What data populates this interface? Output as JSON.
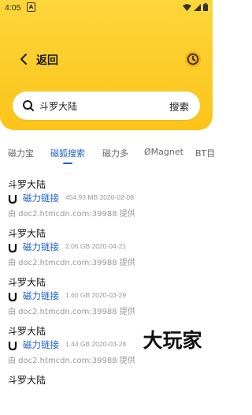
{
  "status": {
    "time": "4:05",
    "notif_badge": "A"
  },
  "header": {
    "title": "返回"
  },
  "search": {
    "query": "斗罗大陆",
    "button": "搜索"
  },
  "tabs": [
    {
      "label": "磁力宝",
      "active": false
    },
    {
      "label": "磁狐搜索",
      "active": true
    },
    {
      "label": "磁力多",
      "active": false
    },
    {
      "label": "ØMagnet",
      "active": false
    },
    {
      "label": "BT目",
      "active": false
    }
  ],
  "results": [
    {
      "title": "斗罗大陆",
      "link": "磁力链接",
      "size": "454.93 MB",
      "date": "2020-02-08",
      "source": "由 doc2.htmcdn.com:39988 提供"
    },
    {
      "title": "斗罗大陆",
      "link": "磁力链接",
      "size": "2.06 GB",
      "date": "2020-04-21",
      "source": "由 doc2.htmcdn.com:39988 提供"
    },
    {
      "title": "斗罗大陆",
      "link": "磁力链接",
      "size": "1.60 GB",
      "date": "2020-03-29",
      "source": "由 doc2.htmcdn.com:39988 提供"
    },
    {
      "title": "斗罗大陆",
      "link": "磁力链接",
      "size": "1.44 GB",
      "date": "2020-03-28",
      "source": "由 doc2.htmcdn.com:39988 提供"
    },
    {
      "title": "斗罗大陆",
      "link": "",
      "size": "",
      "date": "",
      "source": ""
    }
  ],
  "watermark": "大玩家",
  "colors": {
    "accent": "#1a5fd0",
    "header_yellow": "#fcc41a"
  }
}
